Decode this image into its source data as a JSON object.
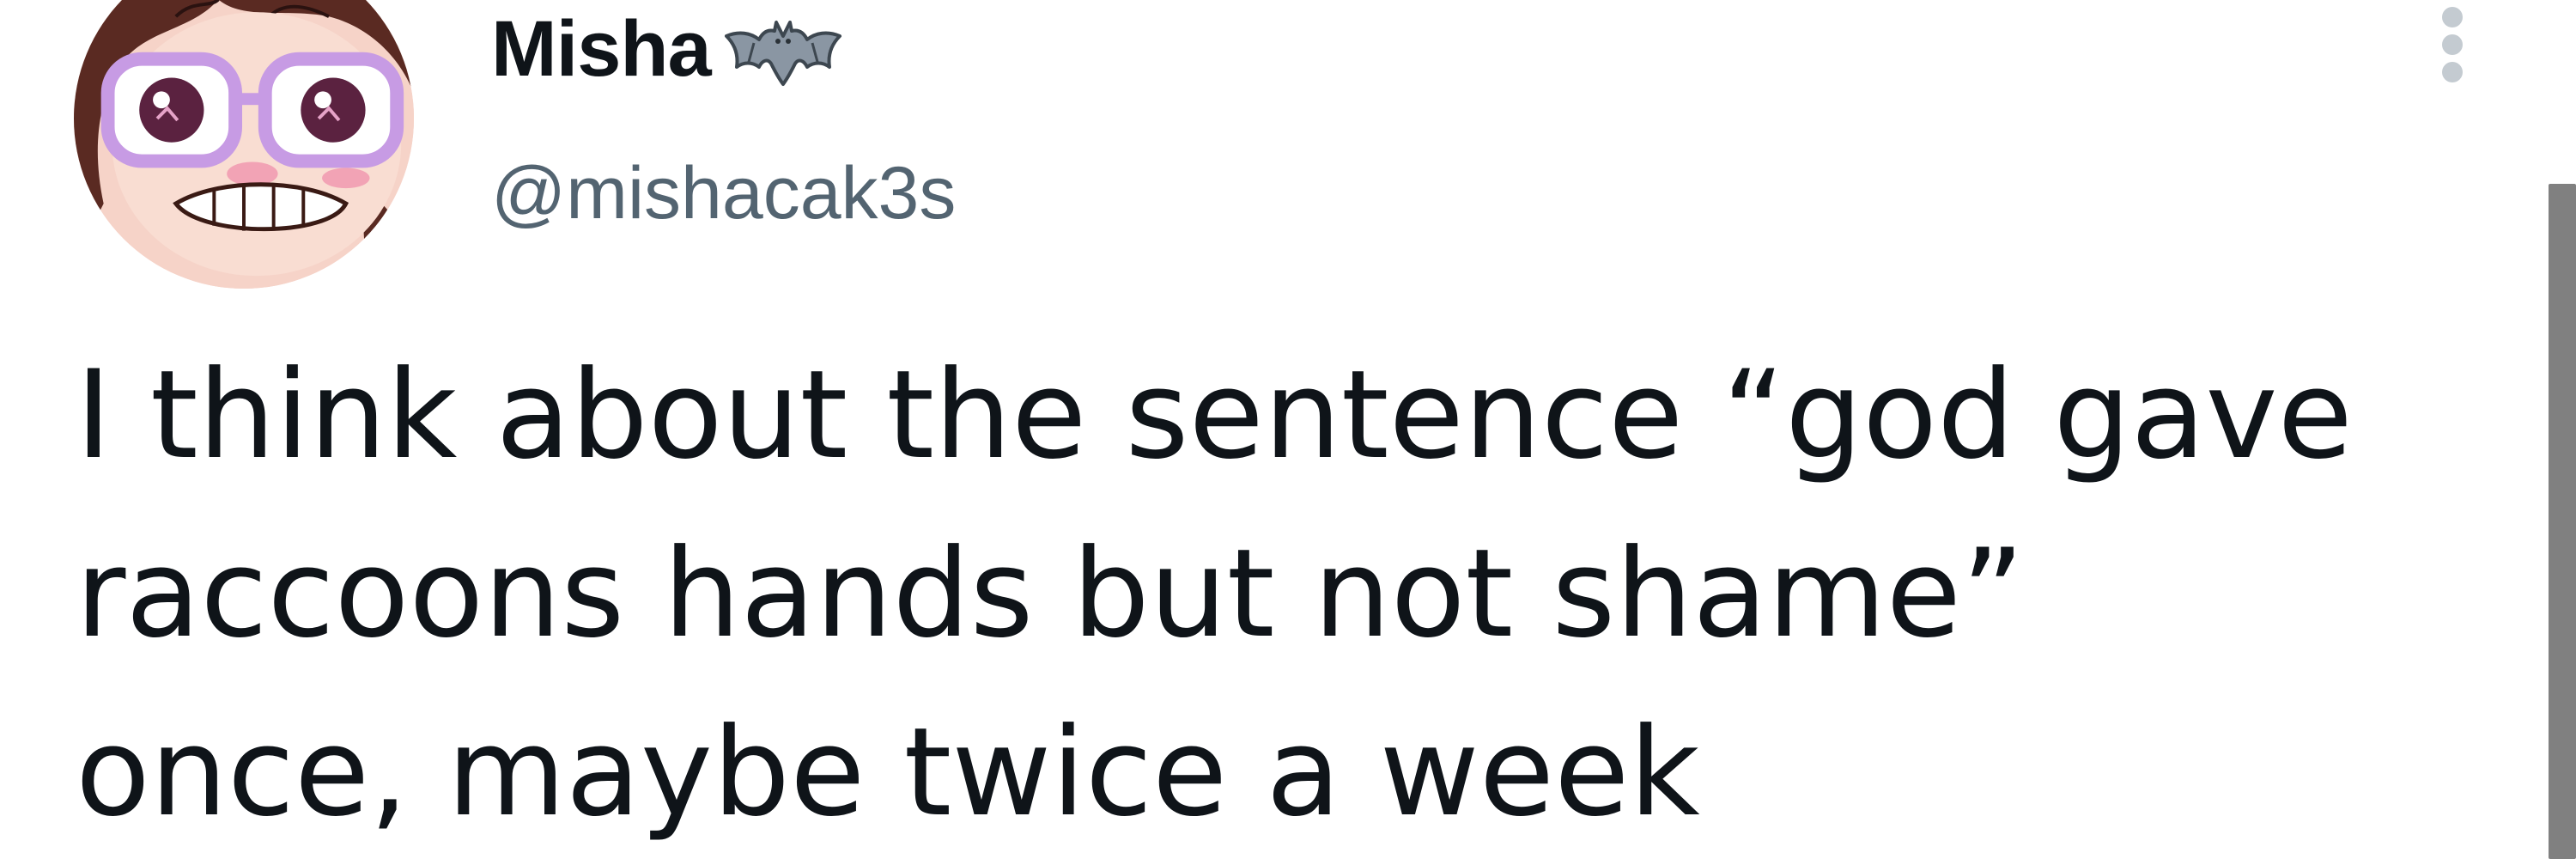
{
  "tweet": {
    "author": {
      "display_name": "Misha",
      "handle": "@mishacak3s",
      "name_icon": "bat-icon",
      "avatar_icon": "avatar-illustration"
    },
    "more_icon": "more-options-icon",
    "text_lines": [
      "I think about the sentence “god gave",
      "raccoons hands but not shame”",
      "once, maybe twice a week"
    ]
  },
  "colors": {
    "text_primary": "#0f1419",
    "text_secondary": "#536471",
    "background": "#ffffff",
    "scrollbar_thumb": "#808080"
  }
}
